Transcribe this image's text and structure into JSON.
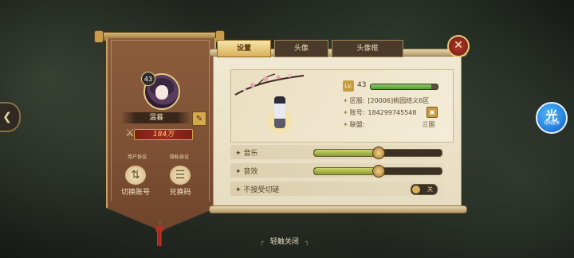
{
  "left_panel": {
    "player_level": "43",
    "player_name": "温暮",
    "power": "184万",
    "user_agreement": "用户协议",
    "privacy_policy": "隐私协议",
    "switch_account": "切换账号",
    "redeem_code": "兑换码"
  },
  "tabs": [
    {
      "label": "设置",
      "active": true
    },
    {
      "label": "头像",
      "active": false
    },
    {
      "label": "头像框",
      "active": false
    }
  ],
  "profile": {
    "level_badge": "Lv.",
    "level": "43",
    "xp_fraction": 0.9,
    "server_label": "区服:",
    "server_value": "[20006]桃园结义6区",
    "account_label": "账号:",
    "account_value": "184299745548",
    "alliance_label": "联盟:",
    "alliance_value": "三国"
  },
  "settings": {
    "music_label": "音乐",
    "music_value": 0.5,
    "sfx_label": "音效",
    "sfx_value": 0.5,
    "no_bump_label": "不接受切磋",
    "no_bump_state": "关"
  },
  "bottom_hint": "轻触关闭",
  "side_badge": {
    "big": "光",
    "small": "光明群英"
  },
  "colors": {
    "accent_gold": "#d8b15c",
    "banner_brown": "#7d5034",
    "power_red": "#a02a20",
    "parchment": "#f1e9d3"
  }
}
